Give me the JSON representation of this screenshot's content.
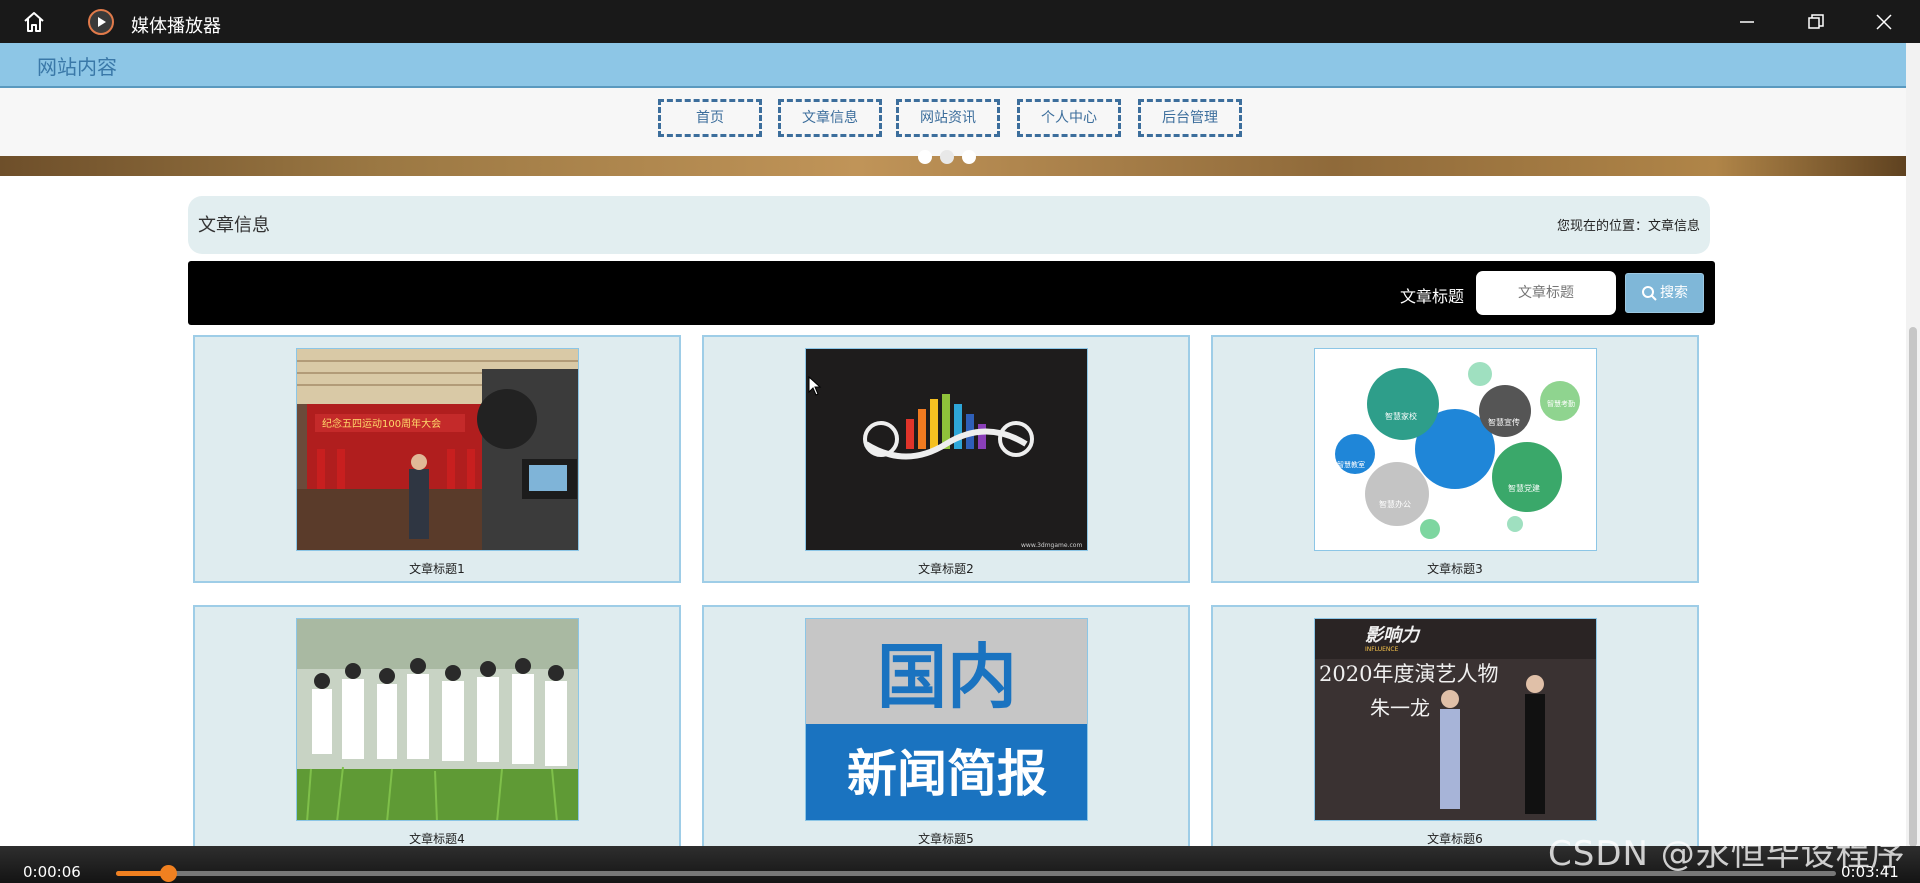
{
  "window": {
    "title": "媒体播放器",
    "icons": {
      "home": "home-icon",
      "app": "play-circle-icon",
      "minimize": "minimize-icon",
      "maximize": "restore-icon",
      "close": "close-icon"
    }
  },
  "site": {
    "name": "网站内容",
    "nav": [
      "首页",
      "文章信息",
      "网站资讯",
      "个人中心",
      "后台管理"
    ]
  },
  "page": {
    "section_title": "文章信息",
    "location": "您现在的位置：文章信息"
  },
  "search": {
    "label": "文章标题",
    "placeholder": "文章标题",
    "button": "搜索",
    "icon": "search-icon"
  },
  "articles": [
    {
      "title": "文章标题1",
      "image_text": "纪念五四运动100周年大会"
    },
    {
      "title": "文章标题2",
      "image_text": "www.3dmgame.com"
    },
    {
      "title": "文章标题3",
      "image_text": [
        "智慧家校",
        "智慧宣传",
        "智慧考勤",
        "智慧党建",
        "智慧办公",
        "智慧教室"
      ]
    },
    {
      "title": "文章标题4"
    },
    {
      "title": "文章标题5",
      "image_text": [
        "国内",
        "新闻简报"
      ]
    },
    {
      "title": "文章标题6",
      "image_text": [
        "影响力",
        "INFLUENCE",
        "2020年度演艺人物",
        "朱一龙"
      ]
    }
  ],
  "player": {
    "current_time": "0:00:06",
    "total_time": "0:03:41",
    "progress": 0.03,
    "accent": "#f08020"
  },
  "watermark": "CSDN @永恒毕设程序",
  "colors": {
    "header_bg": "#8dc6e6",
    "nav_border": "#3c6e9c",
    "card_bg": "#dfecef",
    "search_button": "#7fb7d8"
  }
}
